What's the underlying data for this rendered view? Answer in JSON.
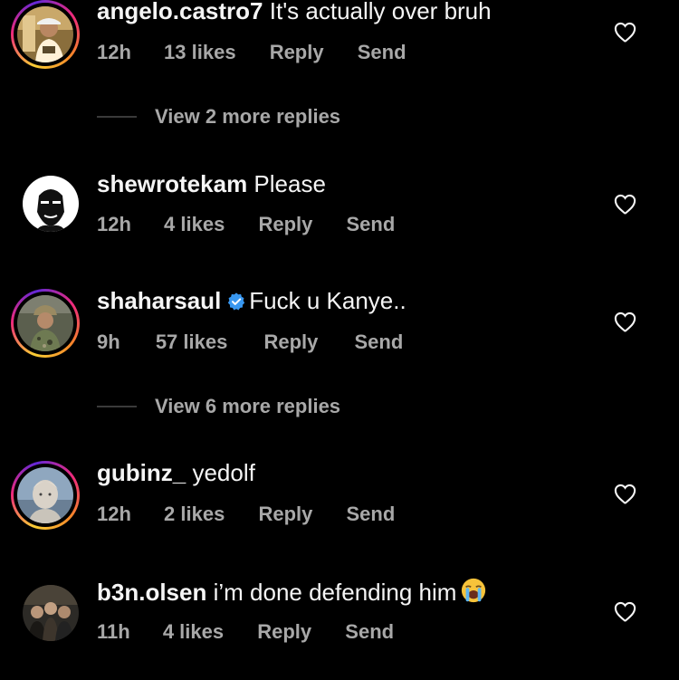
{
  "comments": [
    {
      "username": "angelo.castro7",
      "text": "It's actually over bruh",
      "time": "12h",
      "likes": "13 likes",
      "reply": "Reply",
      "send": "Send",
      "story_ring": true,
      "liked": false
    },
    {
      "username": "shewrotekam",
      "text": "Please",
      "time": "12h",
      "likes": "4 likes",
      "reply": "Reply",
      "send": "Send",
      "story_ring": false,
      "liked": false
    },
    {
      "username": "shaharsaul",
      "verified": true,
      "text": "Fuck u Kanye..",
      "time": "9h",
      "likes": "57 likes",
      "reply": "Reply",
      "send": "Send",
      "story_ring": true,
      "liked": false
    },
    {
      "username": "gubinz_",
      "text": "yedolf",
      "time": "12h",
      "likes": "2 likes",
      "reply": "Reply",
      "send": "Send",
      "story_ring": true,
      "liked": false
    },
    {
      "username": "b3n.olsen",
      "text": "i’m done defending him",
      "emoji": "loudly-crying-face",
      "time": "11h",
      "likes": "4 likes",
      "reply": "Reply",
      "send": "Send",
      "story_ring": false,
      "liked": false
    }
  ],
  "view_replies": [
    {
      "label": "View 2 more replies"
    },
    {
      "label": "View 6 more replies"
    }
  ],
  "colors": {
    "background": "#000000",
    "primary_text": "#f5f5f5",
    "secondary_text": "#a8a8a8",
    "verified_badge": "#3897f0",
    "story_ring": [
      "#f9ce34",
      "#ee2a7b",
      "#6228d7"
    ]
  },
  "icons": {
    "like": "heart-outline-icon",
    "verified": "verified-badge-icon"
  }
}
